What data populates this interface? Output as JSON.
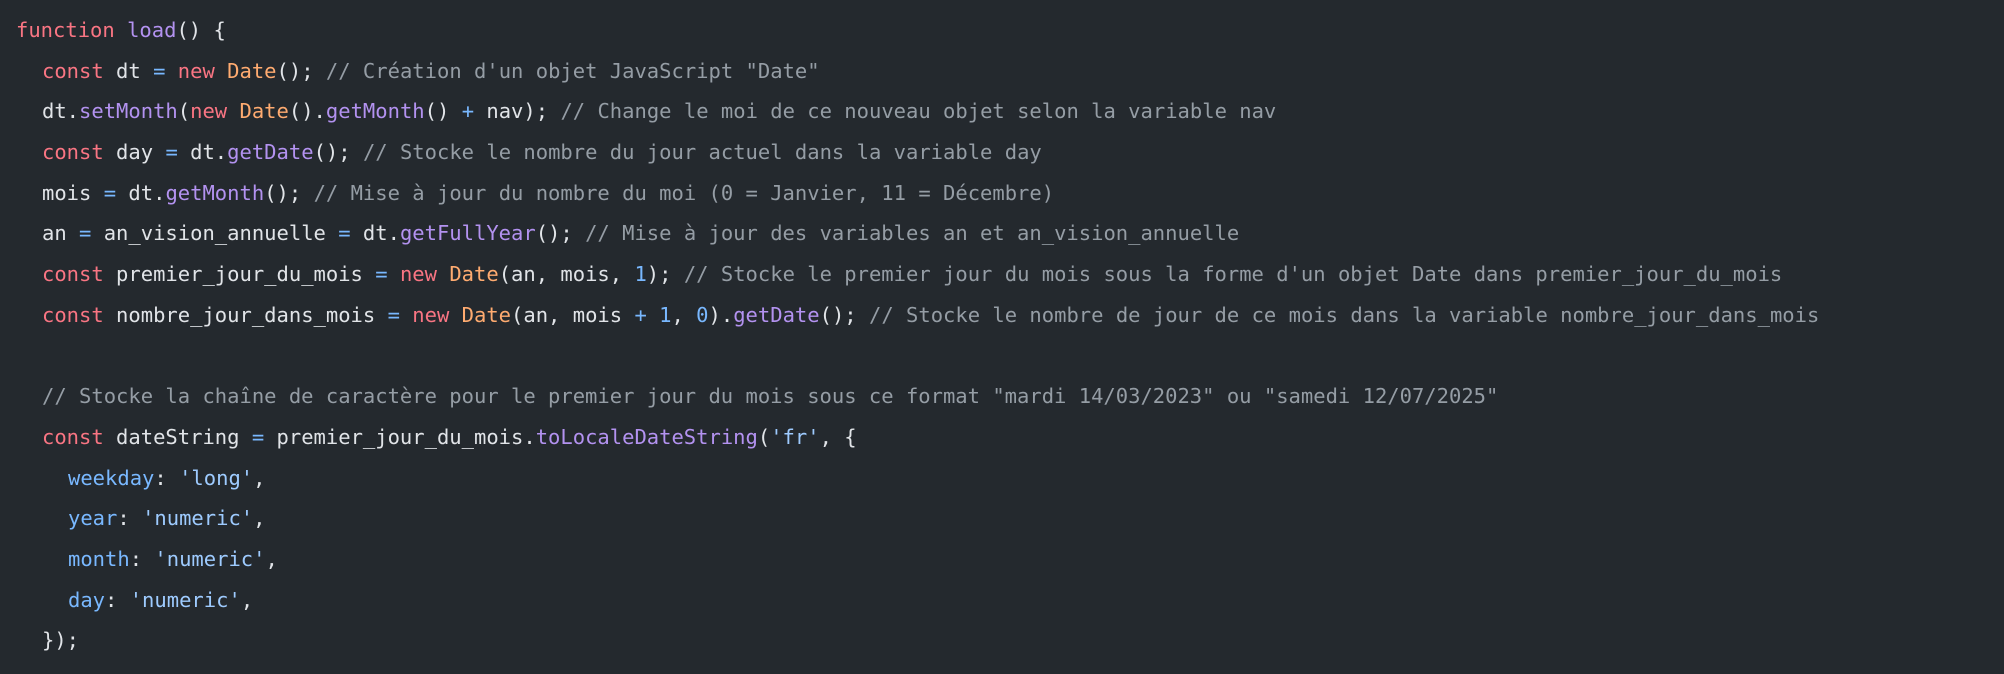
{
  "theme": {
    "background": "#24292e",
    "text": "#e1e4e8",
    "keyword": "#f97583",
    "function": "#b392f0",
    "class": "#ffab70",
    "operator": "#79b8ff",
    "string": "#9ecbff",
    "comment": "#959da5"
  },
  "code": {
    "lines": [
      {
        "indent": 0,
        "tokens": [
          {
            "t": "function",
            "k": "kw"
          },
          {
            "t": " ",
            "k": "tx"
          },
          {
            "t": "load",
            "k": "fn"
          },
          {
            "t": "() {",
            "k": "tx"
          }
        ]
      },
      {
        "indent": 1,
        "tokens": [
          {
            "t": "const",
            "k": "kw"
          },
          {
            "t": " dt ",
            "k": "tx"
          },
          {
            "t": "=",
            "k": "op"
          },
          {
            "t": " ",
            "k": "tx"
          },
          {
            "t": "new",
            "k": "kw"
          },
          {
            "t": " ",
            "k": "tx"
          },
          {
            "t": "Date",
            "k": "cls"
          },
          {
            "t": "(); ",
            "k": "tx"
          },
          {
            "t": "// Création d'un objet JavaScript \"Date\"",
            "k": "cm"
          }
        ]
      },
      {
        "indent": 1,
        "tokens": [
          {
            "t": "dt.",
            "k": "tx"
          },
          {
            "t": "setMonth",
            "k": "fn"
          },
          {
            "t": "(",
            "k": "tx"
          },
          {
            "t": "new",
            "k": "kw"
          },
          {
            "t": " ",
            "k": "tx"
          },
          {
            "t": "Date",
            "k": "cls"
          },
          {
            "t": "().",
            "k": "tx"
          },
          {
            "t": "getMonth",
            "k": "fn"
          },
          {
            "t": "() ",
            "k": "tx"
          },
          {
            "t": "+",
            "k": "op"
          },
          {
            "t": " nav); ",
            "k": "tx"
          },
          {
            "t": "// Change le moi de ce nouveau objet selon la variable nav",
            "k": "cm"
          }
        ]
      },
      {
        "indent": 1,
        "tokens": [
          {
            "t": "const",
            "k": "kw"
          },
          {
            "t": " day ",
            "k": "tx"
          },
          {
            "t": "=",
            "k": "op"
          },
          {
            "t": " dt.",
            "k": "tx"
          },
          {
            "t": "getDate",
            "k": "fn"
          },
          {
            "t": "(); ",
            "k": "tx"
          },
          {
            "t": "// Stocke le nombre du jour actuel dans la variable day",
            "k": "cm"
          }
        ]
      },
      {
        "indent": 1,
        "tokens": [
          {
            "t": "mois ",
            "k": "tx"
          },
          {
            "t": "=",
            "k": "op"
          },
          {
            "t": " dt.",
            "k": "tx"
          },
          {
            "t": "getMonth",
            "k": "fn"
          },
          {
            "t": "(); ",
            "k": "tx"
          },
          {
            "t": "// Mise à jour du nombre du moi (0 = Janvier, 11 = Décembre)",
            "k": "cm"
          }
        ]
      },
      {
        "indent": 1,
        "tokens": [
          {
            "t": "an ",
            "k": "tx"
          },
          {
            "t": "=",
            "k": "op"
          },
          {
            "t": " an_vision_annuelle ",
            "k": "tx"
          },
          {
            "t": "=",
            "k": "op"
          },
          {
            "t": " dt.",
            "k": "tx"
          },
          {
            "t": "getFullYear",
            "k": "fn"
          },
          {
            "t": "(); ",
            "k": "tx"
          },
          {
            "t": "// Mise à jour des variables an et an_vision_annuelle",
            "k": "cm"
          }
        ]
      },
      {
        "indent": 1,
        "tokens": [
          {
            "t": "const",
            "k": "kw"
          },
          {
            "t": " premier_jour_du_mois ",
            "k": "tx"
          },
          {
            "t": "=",
            "k": "op"
          },
          {
            "t": " ",
            "k": "tx"
          },
          {
            "t": "new",
            "k": "kw"
          },
          {
            "t": " ",
            "k": "tx"
          },
          {
            "t": "Date",
            "k": "cls"
          },
          {
            "t": "(an, mois, ",
            "k": "tx"
          },
          {
            "t": "1",
            "k": "num"
          },
          {
            "t": "); ",
            "k": "tx"
          },
          {
            "t": "// Stocke le premier jour du mois sous la forme d'un objet Date dans premier_jour_du_mois",
            "k": "cm"
          }
        ]
      },
      {
        "indent": 1,
        "tokens": [
          {
            "t": "const",
            "k": "kw"
          },
          {
            "t": " nombre_jour_dans_mois ",
            "k": "tx"
          },
          {
            "t": "=",
            "k": "op"
          },
          {
            "t": " ",
            "k": "tx"
          },
          {
            "t": "new",
            "k": "kw"
          },
          {
            "t": " ",
            "k": "tx"
          },
          {
            "t": "Date",
            "k": "cls"
          },
          {
            "t": "(an, mois ",
            "k": "tx"
          },
          {
            "t": "+",
            "k": "op"
          },
          {
            "t": " ",
            "k": "tx"
          },
          {
            "t": "1",
            "k": "num"
          },
          {
            "t": ", ",
            "k": "tx"
          },
          {
            "t": "0",
            "k": "num"
          },
          {
            "t": ").",
            "k": "tx"
          },
          {
            "t": "getDate",
            "k": "fn"
          },
          {
            "t": "(); ",
            "k": "tx"
          },
          {
            "t": "// Stocke le nombre de jour de ce mois dans la variable nombre_jour_dans_mois",
            "k": "cm"
          }
        ]
      },
      {
        "indent": 0,
        "tokens": []
      },
      {
        "indent": 1,
        "tokens": [
          {
            "t": "// Stocke la chaîne de caractère pour le premier jour du mois sous ce format \"mardi 14/03/2023\" ou \"samedi 12/07/2025\"",
            "k": "cm"
          }
        ]
      },
      {
        "indent": 1,
        "tokens": [
          {
            "t": "const",
            "k": "kw"
          },
          {
            "t": " dateString ",
            "k": "tx"
          },
          {
            "t": "=",
            "k": "op"
          },
          {
            "t": " premier_jour_du_mois.",
            "k": "tx"
          },
          {
            "t": "toLocaleDateString",
            "k": "fn"
          },
          {
            "t": "(",
            "k": "tx"
          },
          {
            "t": "'fr'",
            "k": "str"
          },
          {
            "t": ", {",
            "k": "tx"
          }
        ]
      },
      {
        "indent": 2,
        "tokens": [
          {
            "t": "weekday",
            "k": "prop"
          },
          {
            "t": ": ",
            "k": "tx"
          },
          {
            "t": "'long'",
            "k": "str"
          },
          {
            "t": ",",
            "k": "tx"
          }
        ]
      },
      {
        "indent": 2,
        "tokens": [
          {
            "t": "year",
            "k": "prop"
          },
          {
            "t": ": ",
            "k": "tx"
          },
          {
            "t": "'numeric'",
            "k": "str"
          },
          {
            "t": ",",
            "k": "tx"
          }
        ]
      },
      {
        "indent": 2,
        "tokens": [
          {
            "t": "month",
            "k": "prop"
          },
          {
            "t": ": ",
            "k": "tx"
          },
          {
            "t": "'numeric'",
            "k": "str"
          },
          {
            "t": ",",
            "k": "tx"
          }
        ]
      },
      {
        "indent": 2,
        "tokens": [
          {
            "t": "day",
            "k": "prop"
          },
          {
            "t": ": ",
            "k": "tx"
          },
          {
            "t": "'numeric'",
            "k": "str"
          },
          {
            "t": ",",
            "k": "tx"
          }
        ]
      },
      {
        "indent": 1,
        "tokens": [
          {
            "t": "});",
            "k": "tx"
          }
        ]
      }
    ]
  }
}
